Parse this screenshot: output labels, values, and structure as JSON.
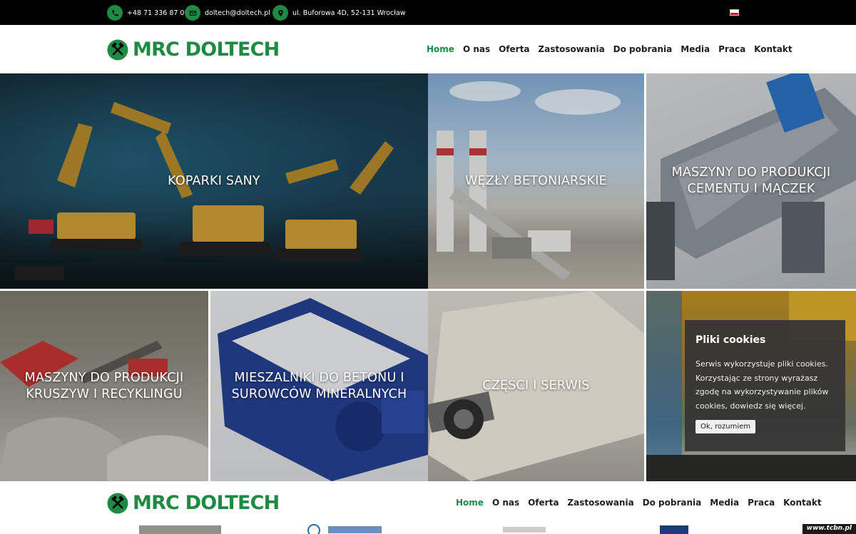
{
  "topbar": {
    "phone": "+48 71 336 87 09",
    "email": "doltech@doltech.pl",
    "address": "ul. Buforowa 4D, 52-131 Wrocław",
    "icon_color": "#1e8a44",
    "language": "pl"
  },
  "brand": {
    "name": "MRC DOLTECH",
    "color": "#1e8a44",
    "icon": "crossed-hammers-icon"
  },
  "nav": {
    "items": [
      {
        "label": "Home",
        "active": true
      },
      {
        "label": "O nas",
        "active": false
      },
      {
        "label": "Oferta",
        "active": false
      },
      {
        "label": "Zastosowania",
        "active": false
      },
      {
        "label": "Do pobrania",
        "active": false
      },
      {
        "label": "Media",
        "active": false
      },
      {
        "label": "Praca",
        "active": false
      },
      {
        "label": "Kontakt",
        "active": false
      }
    ]
  },
  "tiles": [
    {
      "label": "KOPARKI SANY"
    },
    {
      "label": "WĘZŁY BETONIARSKIE"
    },
    {
      "label": "MASZYNY DO PRODUKCJI CEMENTU I MĄCZEK"
    },
    {
      "label": "MASZYNY DO PRODUKCJI KRUSZYW I RECYKLINGU"
    },
    {
      "label": "MIESZALNIKI DO BETONU I SUROWCÓW MINERALNYCH"
    },
    {
      "label": "CZĘŚCI I SERWIS"
    },
    {
      "label": ""
    }
  ],
  "cookie": {
    "title": "Pliki cookies",
    "text": "Serwis wykorzystuje pliki cookies. Korzystając ze strony wyrażasz zgodę na wykorzystywanie plików cookies, dowiedz się więcej.",
    "button": "Ok, rozumiem"
  },
  "watermark": "www.tcbn.pl"
}
